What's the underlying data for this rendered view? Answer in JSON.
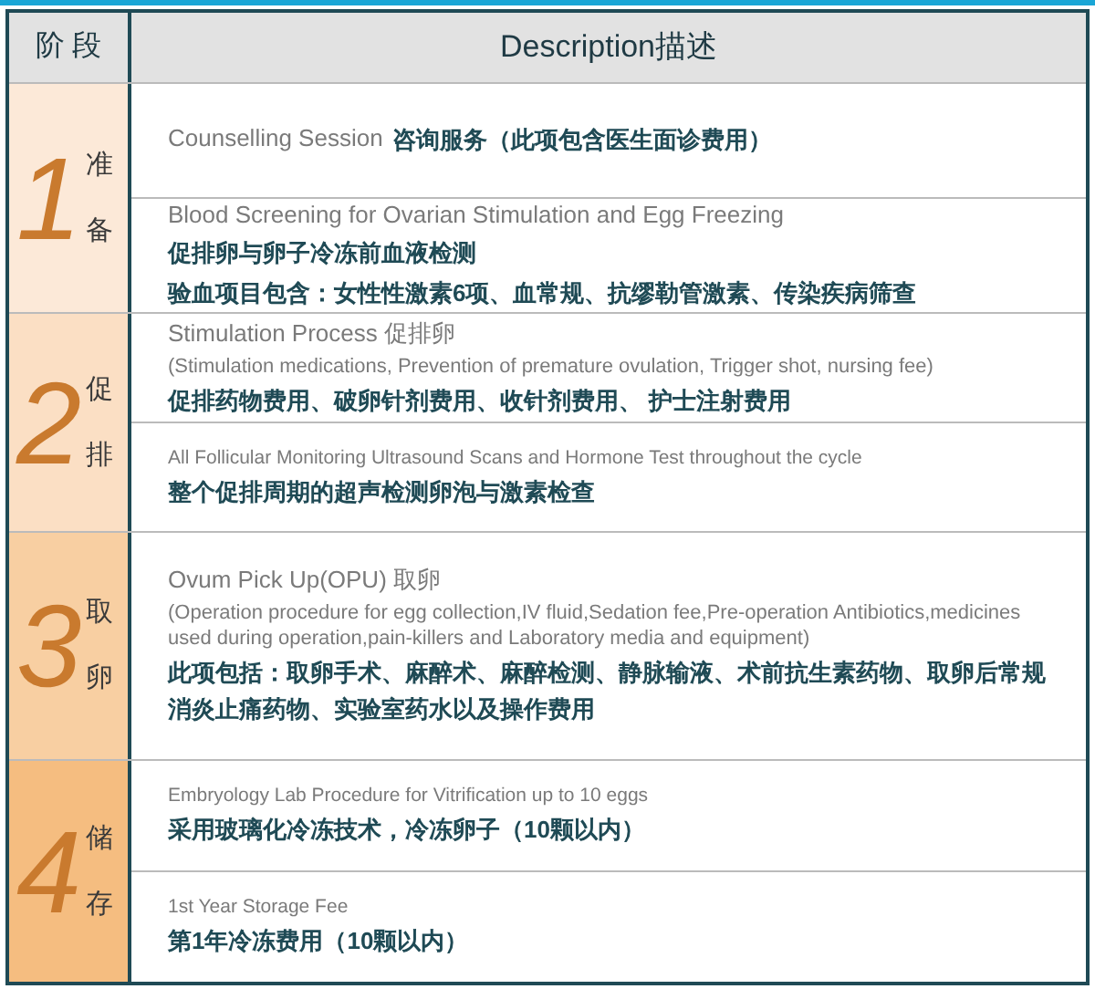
{
  "header": {
    "stage": "阶 段",
    "description": "Description描述"
  },
  "stages": [
    {
      "label": "准备",
      "number": "1",
      "color": "#fce9d8",
      "items": [
        {
          "lines": [
            [
              {
                "kind": "title",
                "text": "Counselling Session"
              },
              {
                "kind": "zh",
                "text": "咨询服务（此项包含医生面诊费用）"
              }
            ]
          ]
        },
        {
          "lines": [
            [
              {
                "kind": "title",
                "text": "Blood Screening for Ovarian Stimulation and Egg Freezing"
              }
            ],
            [
              {
                "kind": "zh",
                "text": "促排卵与卵子冷冻前血液检测"
              }
            ],
            [
              {
                "kind": "zh",
                "text": "验血项目包含：女性性激素6项、血常规、抗缪勒管激素、传染疾病筛查"
              }
            ]
          ]
        }
      ]
    },
    {
      "label": "促排",
      "number": "2",
      "color": "#fbdfc4",
      "items": [
        {
          "lines": [
            [
              {
                "kind": "title",
                "text": "Stimulation Process 促排卵"
              }
            ],
            [
              {
                "kind": "note",
                "text": "(Stimulation medications, Prevention of premature ovulation, Trigger shot, nursing fee)"
              }
            ],
            [
              {
                "kind": "zh",
                "text": "促排药物费用、破卵针剂费用、收针剂费用、 护士注射费用"
              }
            ]
          ]
        },
        {
          "lines": [
            [
              {
                "kind": "small",
                "text": "All Follicular Monitoring Ultrasound Scans and Hormone Test throughout the cycle"
              }
            ],
            [
              {
                "kind": "zh",
                "text": "整个促排周期的超声检测卵泡与激素检查"
              }
            ]
          ]
        }
      ]
    },
    {
      "label": "取卵",
      "number": "3",
      "color": "#f8cfa2",
      "items": [
        {
          "lines": [
            [
              {
                "kind": "title",
                "text": "Ovum Pick Up(OPU) 取卵"
              }
            ],
            [
              {
                "kind": "note",
                "text": "(Operation procedure for egg collection,IV fluid,Sedation fee,Pre-operation Antibiotics,medicines used during operation,pain-killers and Laboratory media and equipment)"
              }
            ],
            [
              {
                "kind": "zh",
                "text": "此项包括：取卵手术、麻醉术、麻醉检测、静脉输液、术前抗生素药物、取卵后常规消炎止痛药物、实验室药水以及操作费用"
              }
            ]
          ]
        }
      ]
    },
    {
      "label": "储存",
      "number": "4",
      "color": "#f5bd80",
      "items": [
        {
          "lines": [
            [
              {
                "kind": "small",
                "text": "Embryology Lab Procedure for Vitrification up to 10 eggs"
              }
            ],
            [
              {
                "kind": "zh",
                "text": "采用玻璃化冷冻技术，冷冻卵子（10颗以内）"
              }
            ]
          ]
        },
        {
          "lines": [
            [
              {
                "kind": "small",
                "text": "1st Year Storage Fee"
              }
            ],
            [
              {
                "kind": "zh",
                "text": "第1年冷冻费用（10颗以内）"
              }
            ]
          ]
        }
      ]
    }
  ]
}
